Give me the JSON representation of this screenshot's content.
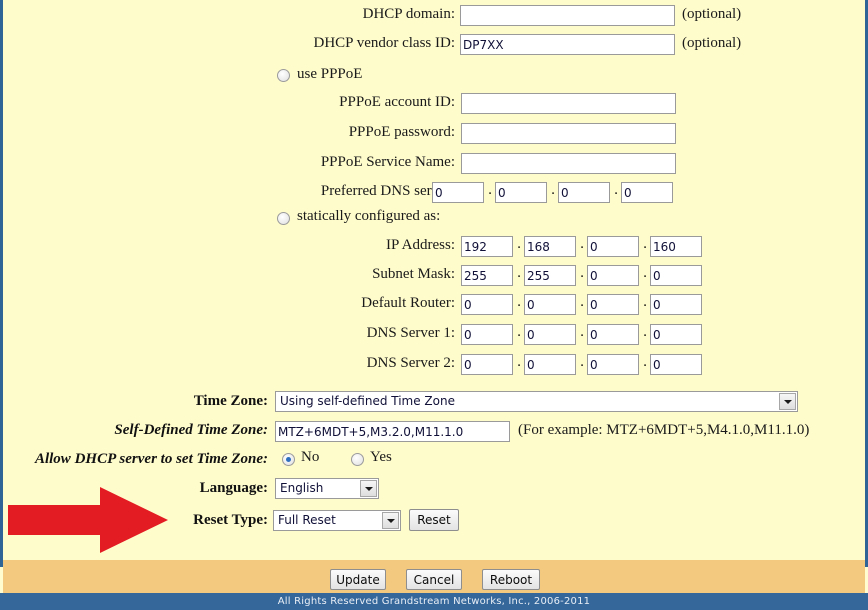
{
  "page": {
    "background_color": "#FFFCCC",
    "accent_bar_color": "#F2C97E",
    "footer_bar_color": "#35679B"
  },
  "network": {
    "dhcp_domain": {
      "label": "DHCP domain:",
      "value": "",
      "note": "(optional)"
    },
    "dhcp_vendor_class_id": {
      "label": "DHCP vendor class ID:",
      "value": "DP7XX",
      "note": "(optional)"
    },
    "use_pppoe": {
      "label": "use PPPoE",
      "selected": false
    },
    "pppoe_account_id": {
      "label": "PPPoE account ID:",
      "value": ""
    },
    "pppoe_password": {
      "label": "PPPoE password:",
      "value": ""
    },
    "pppoe_service_name": {
      "label": "PPPoE Service Name:",
      "value": ""
    },
    "preferred_dns_server": {
      "label": "Preferred DNS server:",
      "octets": [
        "0",
        "0",
        "0",
        "0"
      ]
    },
    "statically_configured": {
      "label": "statically configured as:",
      "selected": false
    },
    "ip_address": {
      "label": "IP Address:",
      "octets": [
        "192",
        "168",
        "0",
        "160"
      ]
    },
    "subnet_mask": {
      "label": "Subnet Mask:",
      "octets": [
        "255",
        "255",
        "0",
        "0"
      ]
    },
    "default_router": {
      "label": "Default Router:",
      "octets": [
        "0",
        "0",
        "0",
        "0"
      ]
    },
    "dns_server_1": {
      "label": "DNS Server 1:",
      "octets": [
        "0",
        "0",
        "0",
        "0"
      ]
    },
    "dns_server_2": {
      "label": "DNS Server 2:",
      "octets": [
        "0",
        "0",
        "0",
        "0"
      ]
    },
    "separator": "."
  },
  "settings": {
    "time_zone": {
      "label": "Time Zone:",
      "value": "Using self-defined Time Zone"
    },
    "self_defined_time_zone": {
      "label": "Self-Defined Time Zone:",
      "value": "MTZ+6MDT+5,M3.2.0,M11.1.0",
      "example": "(For example: MTZ+6MDT+5,M4.1.0,M11.1.0)"
    },
    "allow_dhcp_time_zone": {
      "label": "Allow DHCP server to set Time Zone:",
      "option_no": "No",
      "option_yes": "Yes",
      "selected": "No"
    },
    "language": {
      "label": "Language:",
      "value": "English"
    },
    "reset_type": {
      "label": "Reset Type:",
      "value": "Full Reset",
      "button_label": "Reset"
    }
  },
  "actions": {
    "update": "Update",
    "cancel": "Cancel",
    "reboot": "Reboot"
  },
  "footer": {
    "copyright": "All Rights Reserved  Grandstream Networks, Inc., 2006-2011"
  },
  "annotation": {
    "arrow_color": "#E31B23",
    "points_at": "reset-type-row"
  }
}
